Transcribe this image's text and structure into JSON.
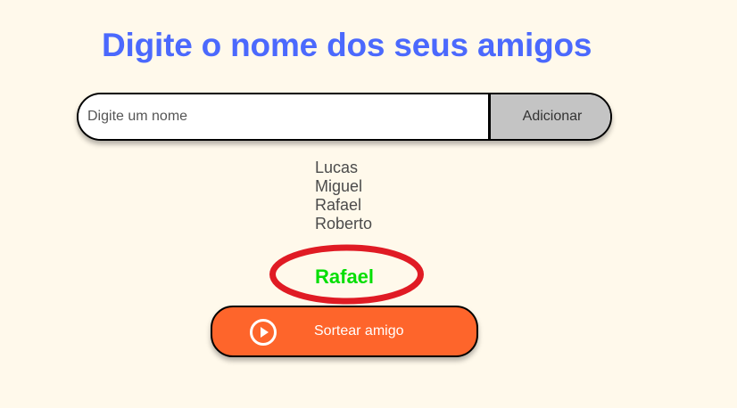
{
  "header": {
    "title": "Digite o nome dos seus amigos"
  },
  "input": {
    "placeholder": "Digite um nome",
    "value": "",
    "add_label": "Adicionar"
  },
  "friends": [
    "Lucas",
    "Miguel",
    "Rafael",
    "Roberto"
  ],
  "result": {
    "name": "Rafael",
    "highlight": "red-ellipse"
  },
  "draw": {
    "label": "Sortear amigo",
    "icon": "play-circle-icon"
  },
  "colors": {
    "background": "#FFF9EB",
    "title": "#4B69FD",
    "add_button": "#C4C4C4",
    "draw_button": "#FE652B",
    "result_text": "#05DF05",
    "highlight_ring": "#E01B24"
  }
}
